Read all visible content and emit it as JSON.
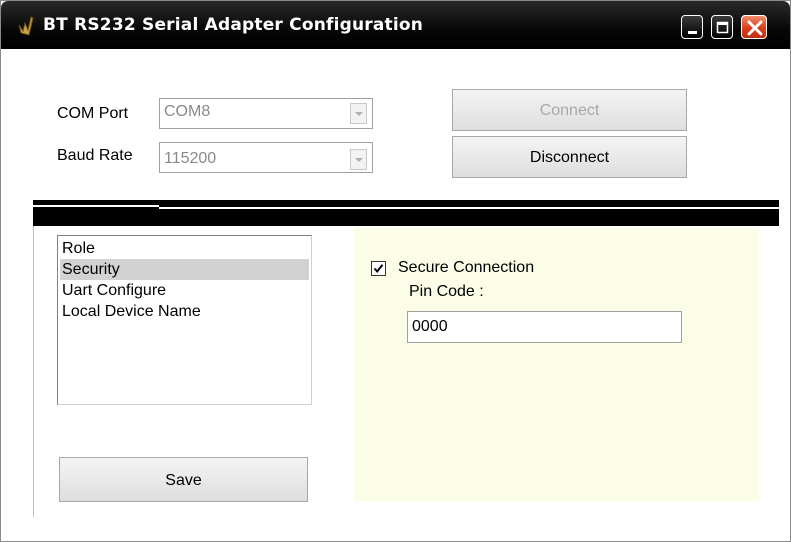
{
  "window": {
    "title": "BT RS232 Serial Adapter Configuration",
    "controls": [
      "minimize-icon",
      "maximize-icon",
      "close-icon"
    ],
    "colors": {
      "titlebar": "#000000",
      "close": "#d8401e",
      "panel_bg": "#fcfde6"
    }
  },
  "connection": {
    "com_port_label": "COM Port",
    "com_port_value": "COM8",
    "baud_rate_label": "Baud Rate",
    "baud_rate_value": "115200",
    "connect_label": "Connect",
    "disconnect_label": "Disconnect"
  },
  "settings_list": {
    "items": [
      "Role",
      "Security",
      "Uart Configure",
      "Local Device Name"
    ],
    "selected": "Security"
  },
  "security": {
    "secure_connection_label": "Secure Connection",
    "secure_connection_checked": true,
    "pin_code_label": "Pin Code :",
    "pin_code_value": "0000"
  },
  "actions": {
    "save_label": "Save"
  }
}
